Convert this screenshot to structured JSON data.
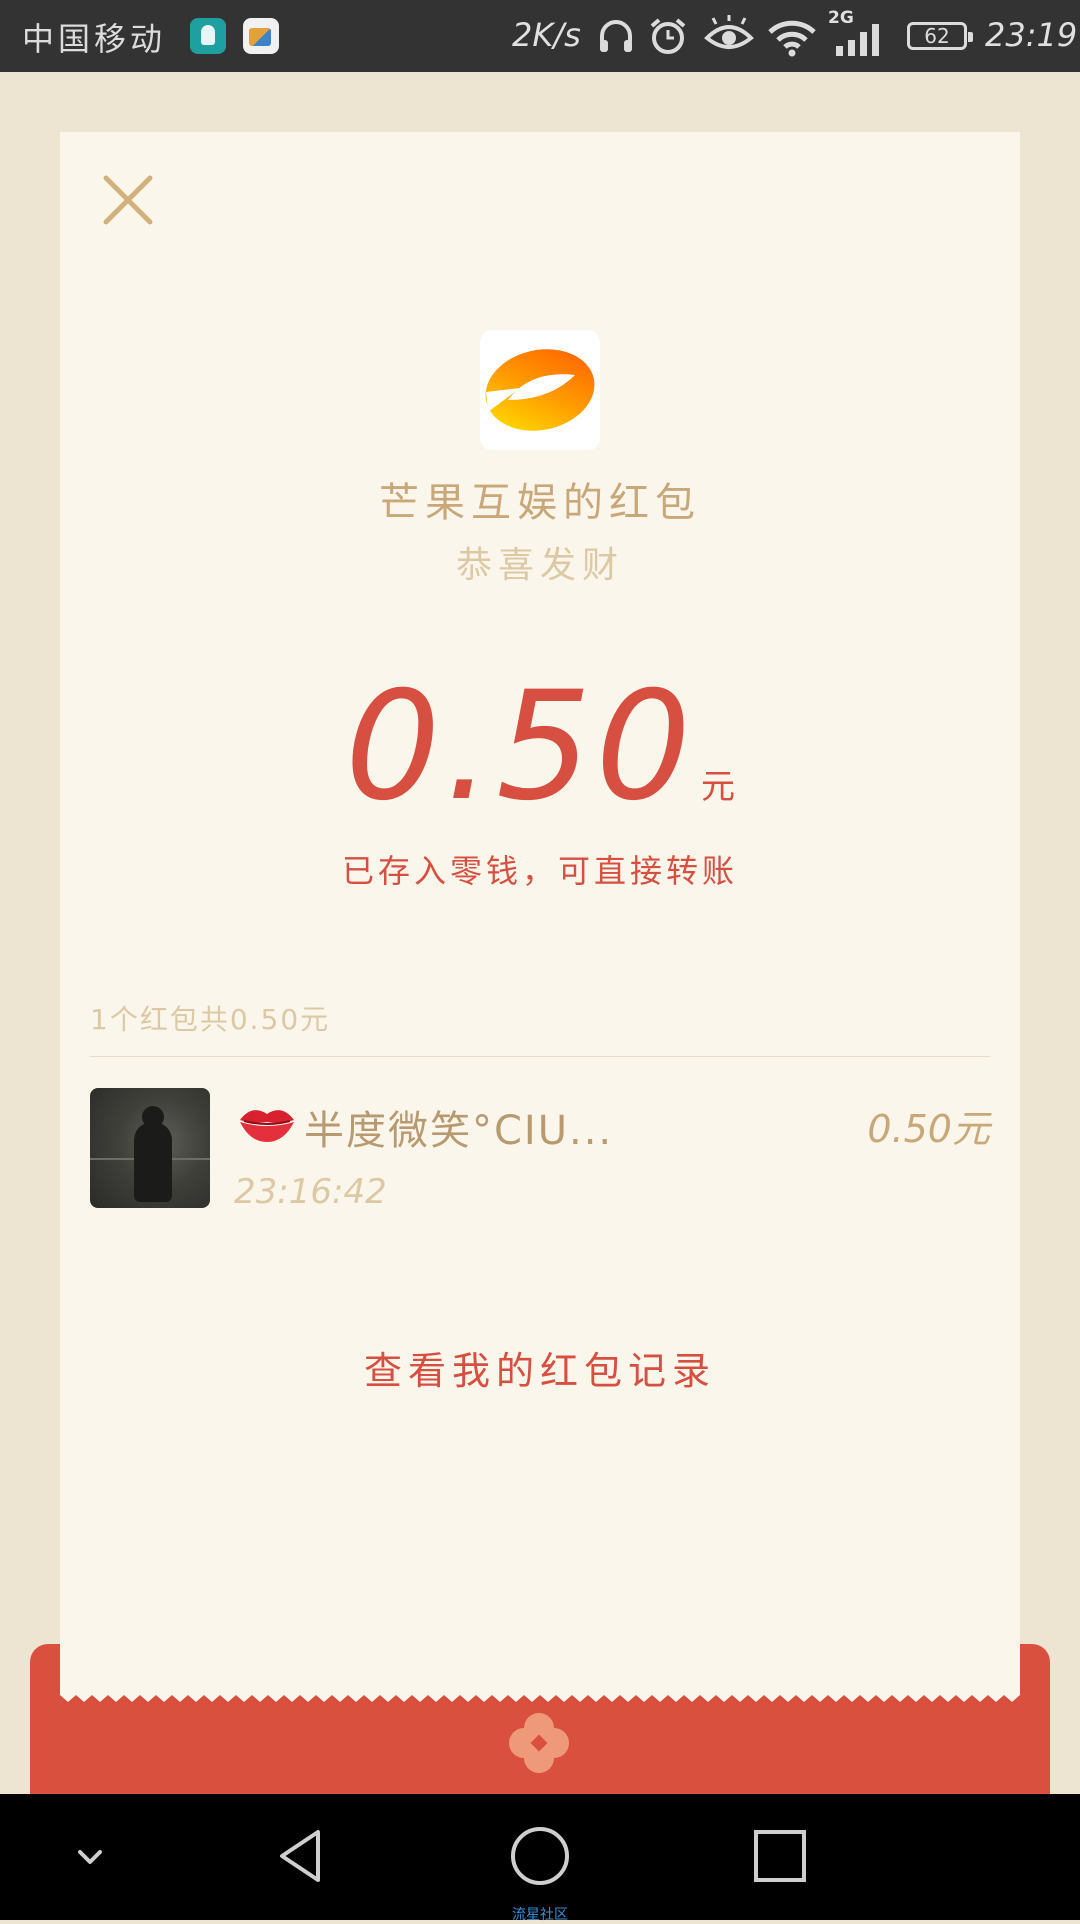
{
  "status_bar": {
    "carrier": "中国移动",
    "net_speed": "2K/s",
    "signal_type": "2G",
    "battery_level": "62",
    "time": "23:19"
  },
  "red_packet": {
    "sender_title": "芒果互娱的红包",
    "greeting": "恭喜发财",
    "amount": "0.50",
    "amount_unit": "元",
    "saved_note": "已存入零钱，可直接转账",
    "summary": "1个红包共0.50元"
  },
  "records": [
    {
      "nickname": "半度微笑°CIU...",
      "amount": "0.50元",
      "time": "23:16:42"
    }
  ],
  "history_link": "查看我的红包记录",
  "watermark": "流星社区",
  "colors": {
    "accent_red": "#d64f40",
    "envelope_red": "#d9503f",
    "gold": "#c8a878",
    "card_bg": "#fbf6eb",
    "page_bg": "#ede5d2"
  },
  "icons": {
    "close": "close-icon",
    "lips": "lips-icon",
    "back": "back-icon",
    "home": "home-icon",
    "recents": "recents-icon",
    "collapse": "chevron-down-icon"
  }
}
